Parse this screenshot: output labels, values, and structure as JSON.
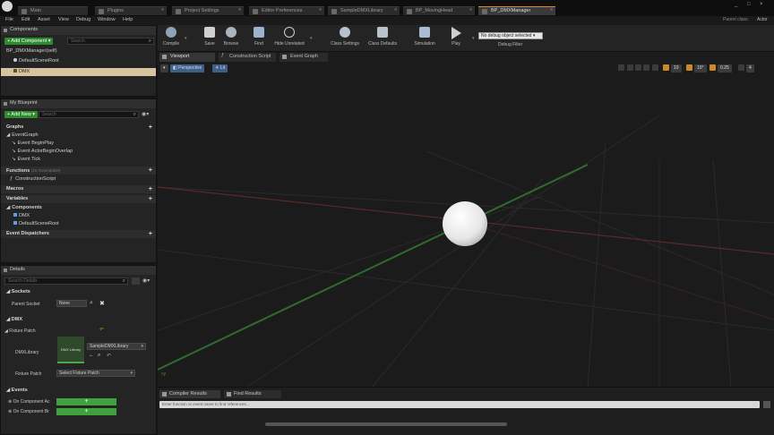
{
  "tabs": [
    {
      "label": "Main"
    },
    {
      "label": "Plugins"
    },
    {
      "label": "Project Settings"
    },
    {
      "label": "Editor Preferences"
    },
    {
      "label": "SampleDMXLibrary"
    },
    {
      "label": "BP_MovingHead"
    },
    {
      "label": "BP_DMXManager"
    }
  ],
  "window": {
    "parent_label": "Parent class:",
    "parent_value": "Actor"
  },
  "menu": [
    "File",
    "Edit",
    "Asset",
    "View",
    "Debug",
    "Window",
    "Help"
  ],
  "components_panel": {
    "title": "Components",
    "add_button": "+ Add Component ▾",
    "search_placeholder": "Search",
    "items": [
      "BP_DMXManager(self)",
      "DefaultSceneRoot",
      "DMX"
    ]
  },
  "blueprint_panel": {
    "title": "My Blueprint",
    "add_button": "+ Add New ▾",
    "search_placeholder": "Search",
    "graphs_label": "Graphs",
    "event_graph": "EventGraph",
    "events": [
      "Event BeginPlay",
      "Event ActorBeginOverlap",
      "Event Tick"
    ],
    "functions_label": "Functions",
    "functions_count": "(16 Overridable)",
    "construction_script": "ConstructionScript",
    "macros_label": "Macros",
    "variables_label": "Variables",
    "components_label": "Components",
    "component_vars": [
      "DMX",
      "DefaultSceneRoot"
    ],
    "dispatchers_label": "Event Dispatchers"
  },
  "details_panel": {
    "title": "Details",
    "search_placeholder": "Search Details",
    "sockets_label": "Sockets",
    "parent_socket_label": "Parent Socket",
    "parent_socket_value": "None",
    "dmx_label": "DMX",
    "fixture_patch_label": "Fixture Patch",
    "dmx_library_label": "DMXLibrary",
    "dmx_library_thumb": "DMX Library",
    "dmx_library_value": "SampleDMXLibrary",
    "fixture_patch_value": "Select Fixture Patch",
    "events_label": "Events",
    "event_rows": [
      "On Component Ac",
      "On Component Br"
    ]
  },
  "toolbar": {
    "compile": "Compile",
    "save": "Save",
    "browse": "Browse",
    "find": "Find",
    "hide_unrelated": "Hide Unrelated",
    "class_settings": "Class Settings",
    "class_defaults": "Class Defaults",
    "simulation": "Simulation",
    "play": "Play",
    "debug_select": "No debug object selected ▾",
    "debug_filter": "Debug Filter"
  },
  "editor_tabs": [
    "Viewport",
    "Construction Script",
    "Event Graph"
  ],
  "viewport": {
    "perspective": "Perspective",
    "lit": "Lit",
    "grid_snap": "10",
    "rot_snap": "10°",
    "scale_snap": "0.25",
    "cam_speed": "4"
  },
  "bottom_tabs": [
    "Compiler Results",
    "Find Results"
  ],
  "command_placeholder": "Enter function or event name to find references..."
}
